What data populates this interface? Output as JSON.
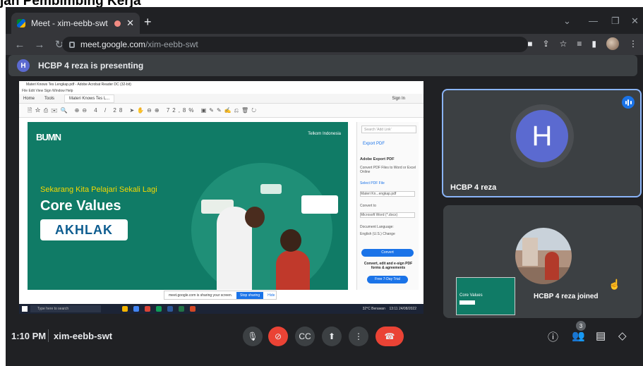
{
  "caption": "jan Pembimbing Kerja",
  "browser": {
    "tab_title": "Meet - xim-eebb-swt",
    "tab_close": "✕",
    "new_tab": "+",
    "url_host": "meet.google.com",
    "url_path": "/xim-eebb-swt"
  },
  "banner": {
    "initial": "H",
    "text": "HCBP 4 reza is presenting"
  },
  "shared": {
    "window_title": "Materi Knows Tes Lengkap.pdf - Adobe Acrobat Reader DC (32-bit)",
    "menu": "File  Edit  View  Sign  Window  Help",
    "tabs": [
      "Home",
      "Tools",
      "Materi Knows Tes L..."
    ],
    "signin": "Sign In",
    "page_indicator": "4 / 28",
    "zoom": "72,8%",
    "slide": {
      "bumn_logo": "BUMN",
      "telkom_logo": "Telkom Indonesia",
      "line1": "Sekarang Kita Pelajari Sekali Lagi",
      "line2": "Core Values",
      "line3": "AKHLAK"
    },
    "panel": {
      "search": "Search 'Add Link'",
      "export": "Export PDF",
      "export_heading": "Adobe Export PDF",
      "export_desc": "Convert PDF Files to Word or Excel Online",
      "select_file": "Select PDF File",
      "file_name": "Materi Kn...engkap.pdf",
      "convert_to": "Convert to",
      "format": "Microsoft Word (*.docx)",
      "doc_lang": "Document Language:",
      "lang": "English (U.S.)  Change",
      "convert_btn": "Convert",
      "promo": "Convert, edit and e-sign PDF forms & agreements",
      "trial_btn": "Free 7-Day Trial"
    },
    "share_notice": "meet.google.com is sharing your screen.",
    "stop_sharing": "Stop sharing",
    "hide": "Hide",
    "taskbar_search": "Type here to search",
    "weather": "32°C  Berawan",
    "clock": "13:11  24/08/2022"
  },
  "tiles": {
    "presenter_initial": "H",
    "presenter_name": "HCBP 4 reza",
    "toast": "HCBP 4 reza joined",
    "thumb_line": "Core Values",
    "thumb_word": "AKHLAK"
  },
  "controls": {
    "time": "1:10 PM",
    "meeting_code": "xim-eebb-swt",
    "participants_count": "3"
  },
  "colors": {
    "end_call": "#ea4335",
    "accent": "#8ab4f8",
    "avatar": "#5b6ad0",
    "slide_bg": "#107b66"
  }
}
